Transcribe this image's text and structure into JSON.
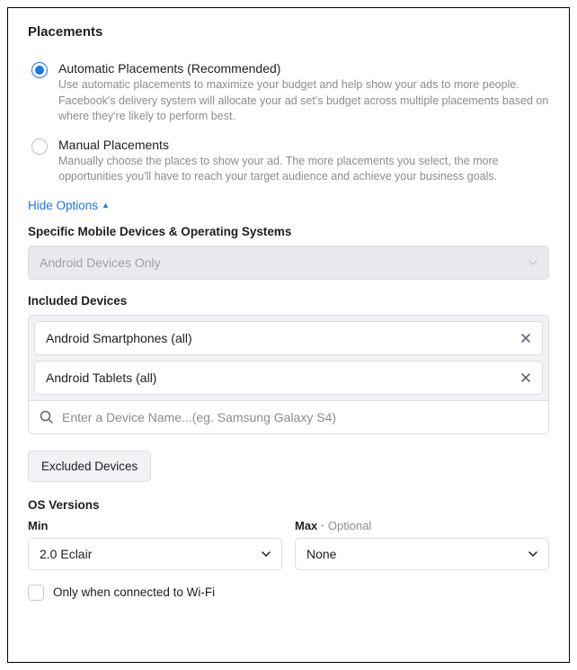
{
  "title": "Placements",
  "radio": {
    "auto": {
      "label": "Automatic Placements (Recommended)",
      "desc": "Use automatic placements to maximize your budget and help show your ads to more people. Facebook's delivery system will allocate your ad set's budget across multiple placements based on where they're likely to perform best."
    },
    "manual": {
      "label": "Manual Placements",
      "desc": "Manually choose the places to show your ad. The more placements you select, the more opportunities you'll have to reach your target audience and achieve your business goals."
    }
  },
  "hideOptions": "Hide Options",
  "devicesHeader": "Specific Mobile Devices & Operating Systems",
  "devicesSelectValue": "Android Devices Only",
  "included": {
    "header": "Included Devices",
    "chips": [
      "Android Smartphones (all)",
      "Android Tablets (all)"
    ],
    "searchPlaceholder": "Enter a Device Name...(eg. Samsung Galaxy S4)"
  },
  "excluded": {
    "label": "Excluded Devices"
  },
  "os": {
    "header": "OS Versions",
    "minLabel": "Min",
    "maxLabel": "Max",
    "optional": "Optional",
    "minValue": "2.0 Eclair",
    "maxValue": "None"
  },
  "wifi": {
    "label": "Only when connected to Wi-Fi"
  }
}
